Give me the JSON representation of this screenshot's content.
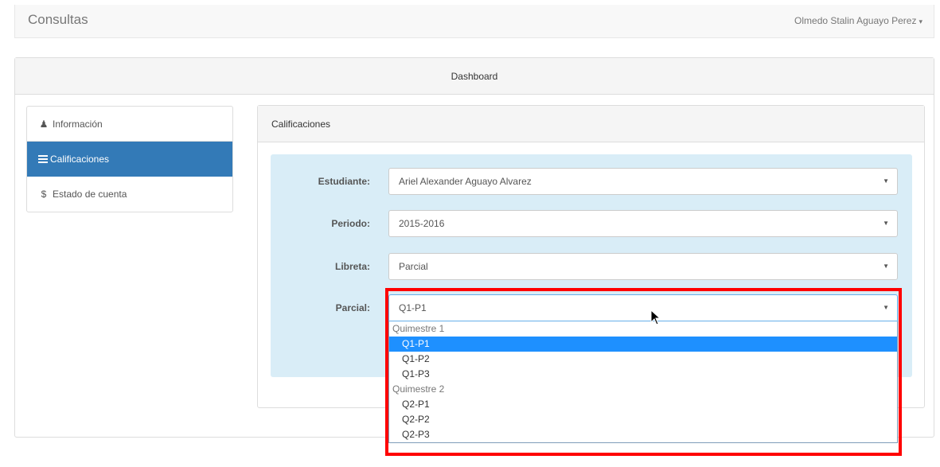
{
  "navbar": {
    "brand": "Consultas",
    "user": "Olmedo Stalin Aguayo Perez"
  },
  "dashboard": {
    "title": "Dashboard"
  },
  "sidebar": {
    "items": [
      {
        "label": "Información",
        "icon": "user-icon"
      },
      {
        "label": "Calificaciones",
        "icon": "list-icon",
        "active": true
      },
      {
        "label": "Estado de cuenta",
        "icon": "dollar-icon"
      }
    ]
  },
  "panel": {
    "title": "Calificaciones"
  },
  "form": {
    "student_label": "Estudiante:",
    "student_value": "Ariel Alexander Aguayo Alvarez",
    "period_label": "Periodo:",
    "period_value": "2015-2016",
    "booklet_label": "Libreta:",
    "booklet_value": "Parcial",
    "partial_label": "Parcial:",
    "partial_value": "Q1-P1"
  },
  "partial_options": [
    {
      "group": "Quimestre 1",
      "options": [
        "Q1-P1",
        "Q1-P2",
        "Q1-P3"
      ]
    },
    {
      "group": "Quimestre 2",
      "options": [
        "Q2-P1",
        "Q2-P2",
        "Q2-P3"
      ]
    }
  ],
  "selected_option": "Q1-P1",
  "colors": {
    "primary": "#337ab7",
    "well": "#d9edf7",
    "highlight": "#ff0000",
    "selected": "#1e90ff"
  }
}
